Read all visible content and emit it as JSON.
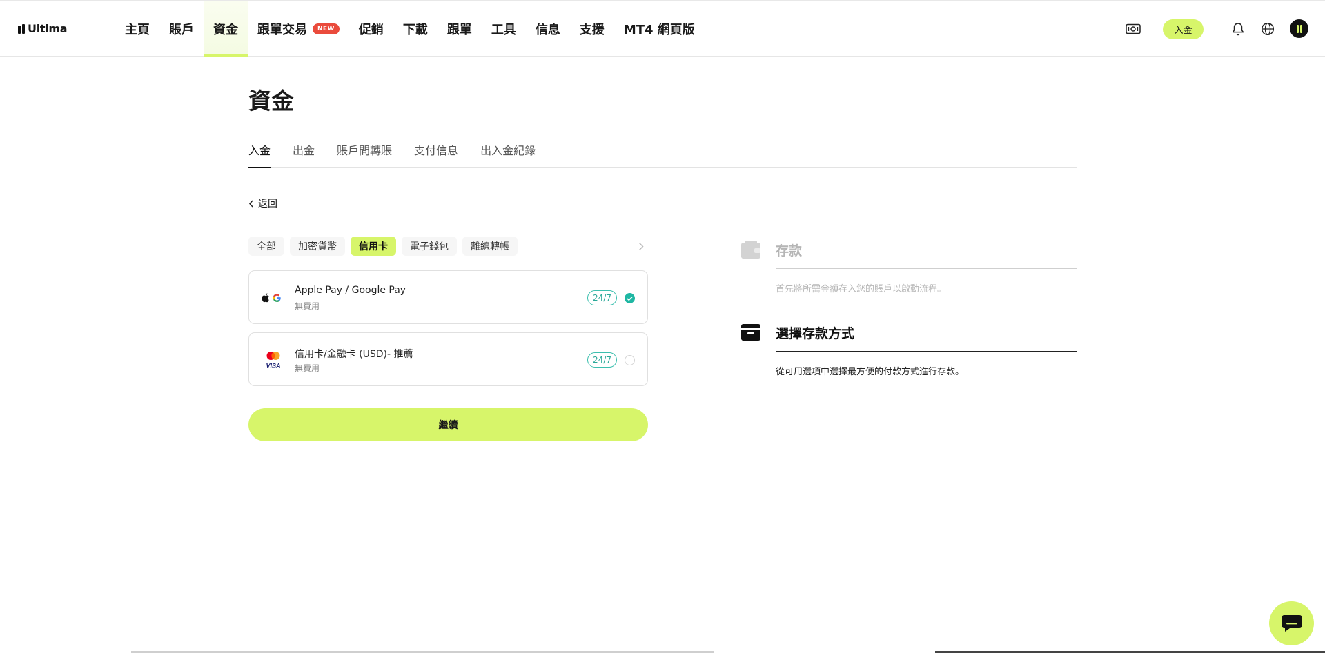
{
  "brand": {
    "name": "Ultima"
  },
  "nav": {
    "items": [
      {
        "label": "主頁"
      },
      {
        "label": "賬戶"
      },
      {
        "label": "資金",
        "active": true
      },
      {
        "label": "跟單交易",
        "badge": "NEW"
      },
      {
        "label": "促銷"
      },
      {
        "label": "下載"
      },
      {
        "label": "跟單"
      },
      {
        "label": "工具"
      },
      {
        "label": "信息"
      },
      {
        "label": "支援"
      },
      {
        "label": "MT4 網頁版"
      }
    ]
  },
  "header": {
    "deposit_label": "入金"
  },
  "page": {
    "title": "資金",
    "tabs": [
      {
        "label": "入金",
        "active": true
      },
      {
        "label": "出金"
      },
      {
        "label": "賬戶間轉賬"
      },
      {
        "label": "支付信息"
      },
      {
        "label": "出入金紀錄"
      }
    ],
    "back_label": "返回"
  },
  "filters": [
    {
      "label": "全部"
    },
    {
      "label": "加密貨幣"
    },
    {
      "label": "信用卡",
      "active": true
    },
    {
      "label": "電子錢包"
    },
    {
      "label": "離線轉帳"
    }
  ],
  "methods": [
    {
      "name": "Apple Pay / Google Pay",
      "fee": "無費用",
      "availability": "24/7",
      "selected": true
    },
    {
      "name": "信用卡/金融卡 (USD)- 推薦",
      "fee": "無費用",
      "availability": "24/7",
      "selected": false
    }
  ],
  "continue_label": "繼續",
  "steps": [
    {
      "title": "存款",
      "description": "首先將所需金額存入您的賬戶以啟動流程。",
      "state": "done"
    },
    {
      "title": "選擇存款方式",
      "description": "從可用選項中選擇最方便的付款方式進行存款。",
      "state": "current"
    }
  ],
  "colors": {
    "accent": "#d7f56a",
    "teal": "#1fb7a3",
    "badge_red": "#ea4b3c"
  }
}
